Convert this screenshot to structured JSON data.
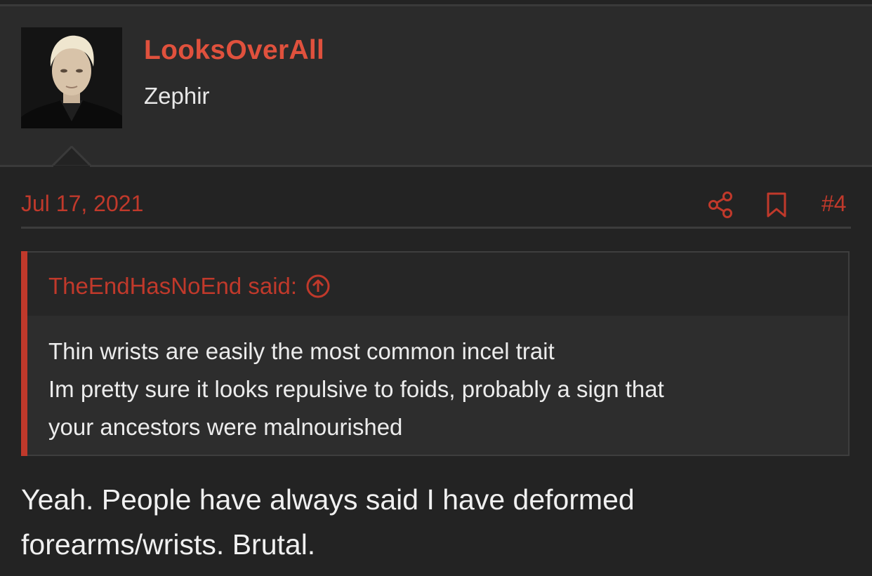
{
  "user": {
    "username": "LooksOverAll",
    "title": "Zephir"
  },
  "post": {
    "date": "Jul 17, 2021",
    "number": "#4",
    "share_icon": "share-icon",
    "bookmark_icon": "bookmark-icon",
    "quote": {
      "author_text": "TheEndHasNoEnd said:",
      "jump_icon": "arrow-up-circle-icon",
      "lines": [
        "Thin wrists are easily the most common incel trait",
        "Im pretty sure it looks repulsive to foids, probably a sign that",
        "your ancestors were malnourished"
      ]
    },
    "body_lines": [
      "Yeah. People have always said I have deformed",
      "forearms/wrists. Brutal."
    ]
  },
  "colors": {
    "accent": "#c0392b",
    "username": "#e0513d",
    "background": "#232323",
    "header_background": "#2b2b2b"
  }
}
